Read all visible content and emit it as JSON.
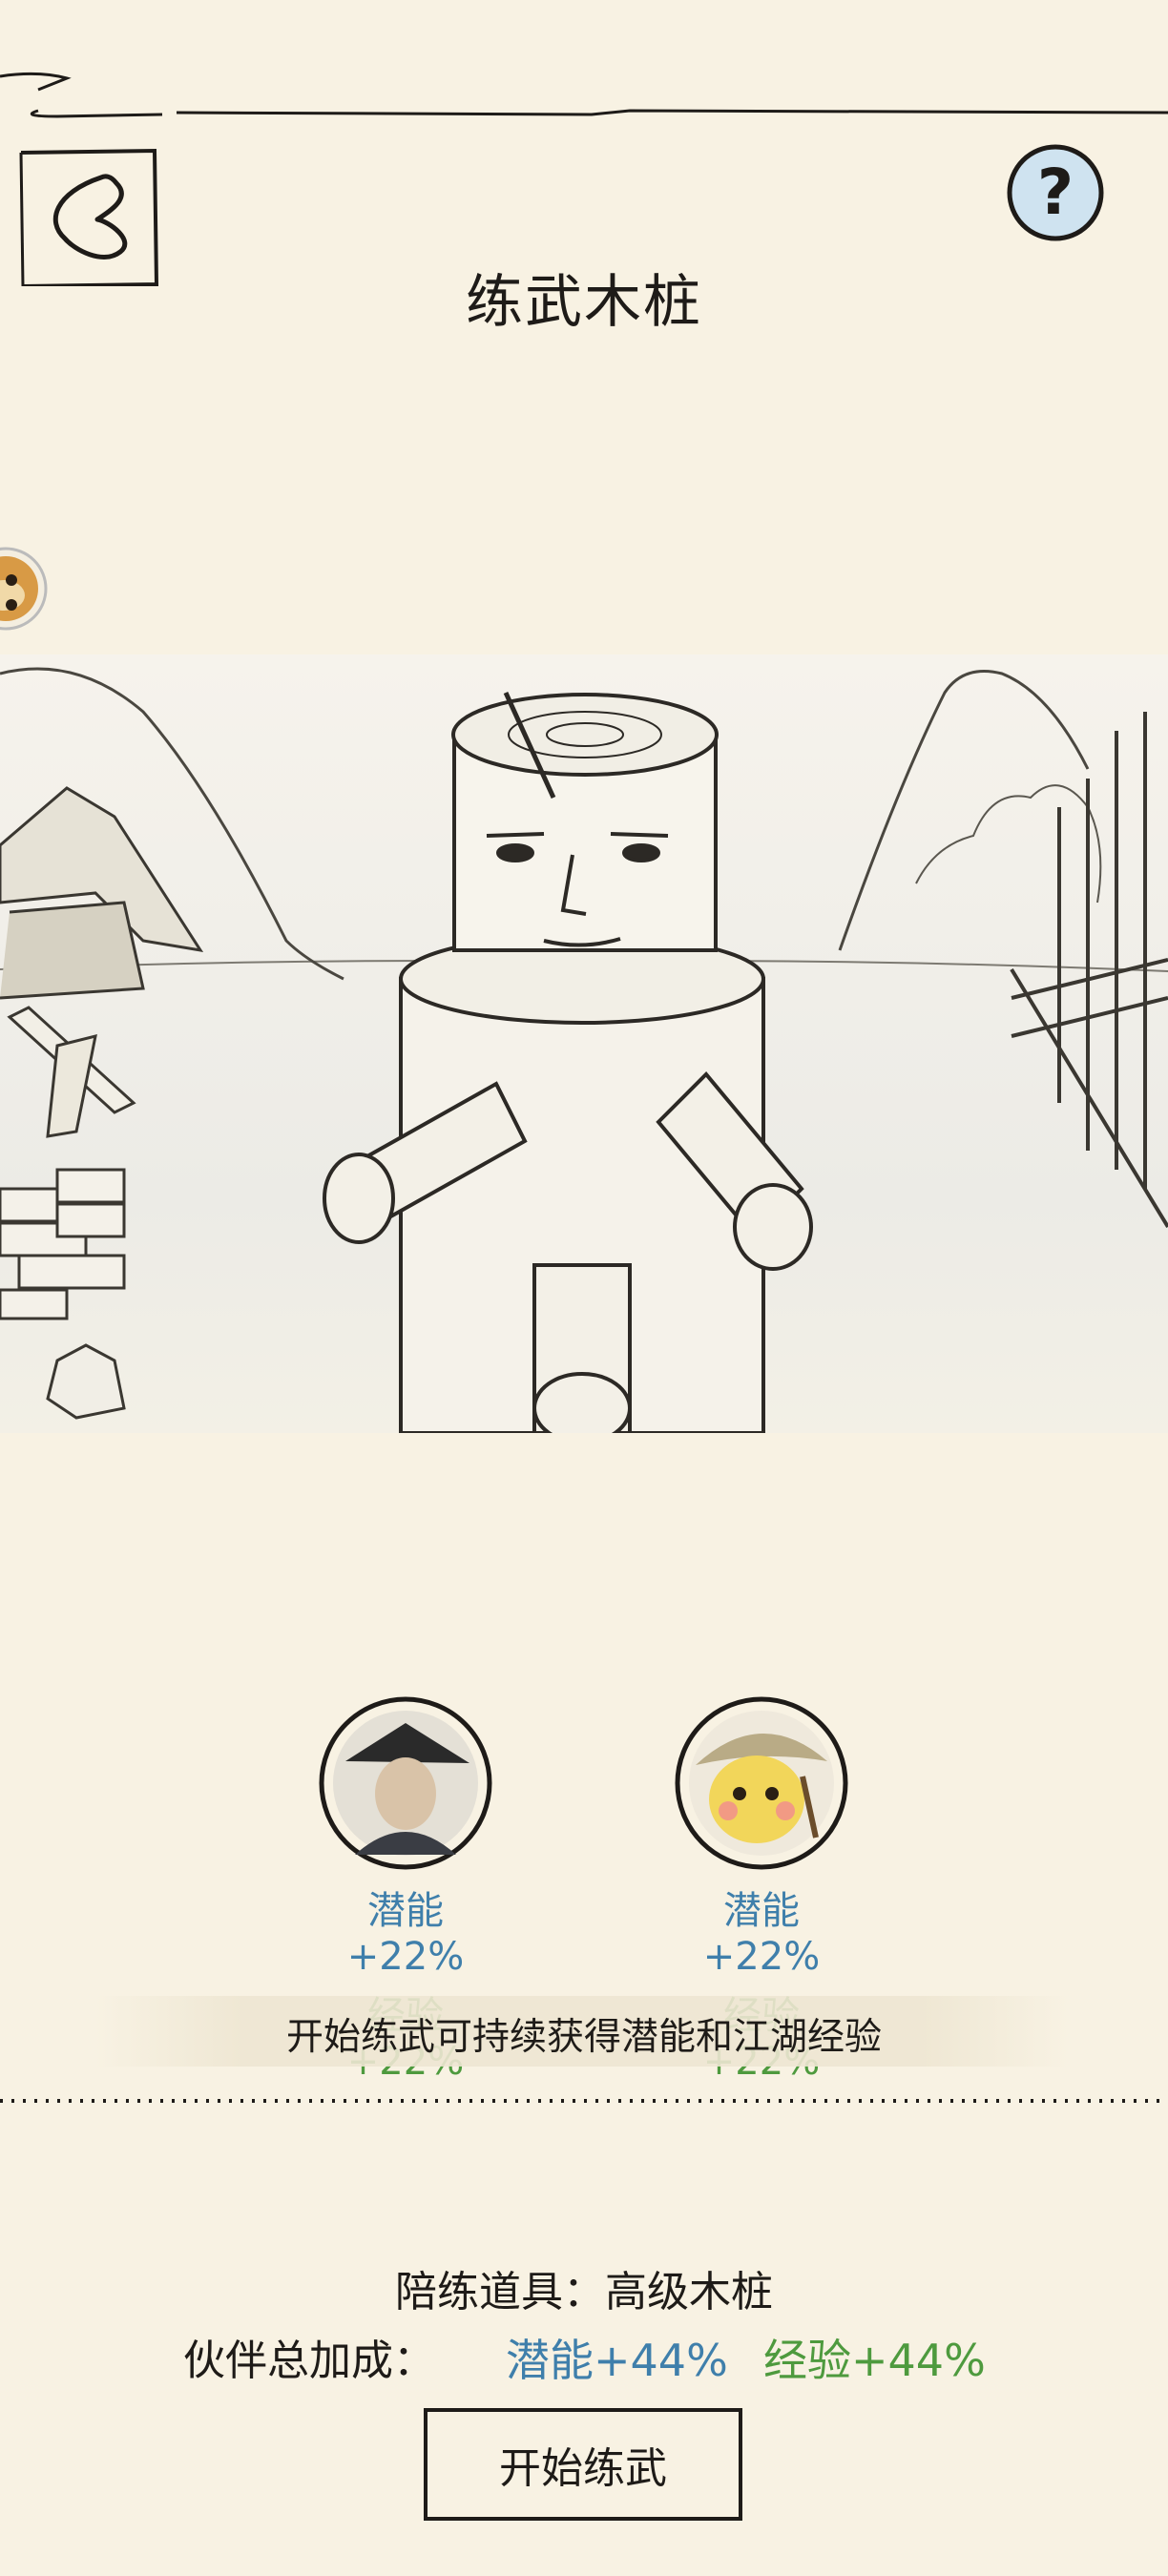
{
  "header": {
    "title": "练武木桩",
    "back_icon": "back-chevron-icon",
    "help_icon": "question-mark-icon"
  },
  "partners": [
    {
      "name_icon": "swordsman-avatar",
      "potential": "潜能+22%",
      "experience": "经验+22%"
    },
    {
      "name_icon": "yellow-cat-avatar",
      "potential": "潜能+22%",
      "experience": "经验+22%"
    }
  ],
  "description": "开始练武可持续获得潜能和江湖经验",
  "training_tool": "陪练道具：高级木桩",
  "bonus": {
    "label": "伙伴总加成：",
    "potential": "潜能+44%",
    "experience": "经验+44%"
  },
  "start_button": "开始练武",
  "colors": {
    "background": "#f8f2e3",
    "potential_blue": "#3f7fab",
    "experience_green": "#4e9a3e",
    "ink": "#1e1b18",
    "help_bg": "#cfe3f0"
  }
}
